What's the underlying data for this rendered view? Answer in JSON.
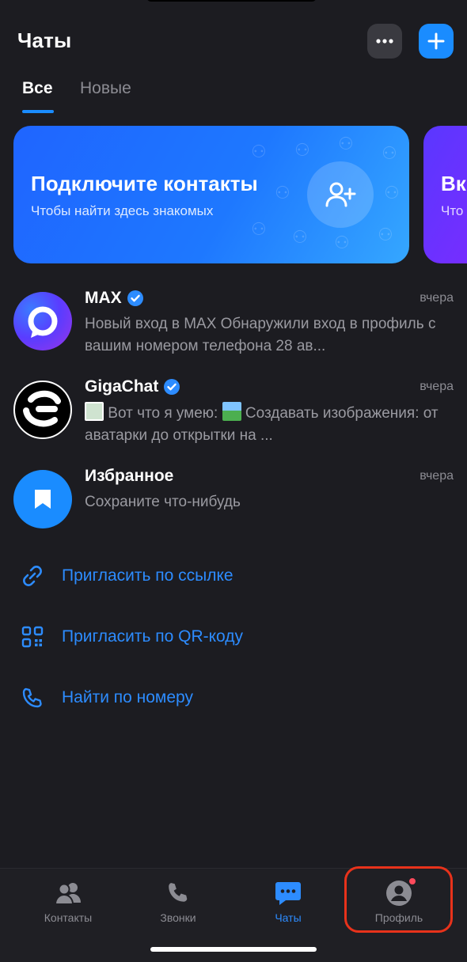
{
  "header": {
    "title": "Чаты",
    "more_icon": "more-icon",
    "add_icon": "plus-icon"
  },
  "tabs": [
    {
      "label": "Все",
      "active": true
    },
    {
      "label": "Новые",
      "active": false
    }
  ],
  "banner": {
    "title": "Подключите контакты",
    "subtitle": "Чтобы найти здесь знакомых",
    "icon": "add-user-icon"
  },
  "banner2": {
    "title": "Вк",
    "subtitle": "Что"
  },
  "chats": [
    {
      "name": "MAX",
      "verified": true,
      "time": "вчера",
      "text": "Новый вход в MAX Обнаружили вход в профиль с вашим номером телефона 28 ав..."
    },
    {
      "name": "GigaChat",
      "verified": true,
      "time": "вчера",
      "text_prefix": "Вот что я умею:",
      "text_rest": "Создавать изображения: от аватарки до открытки на ..."
    },
    {
      "name": "Избранное",
      "verified": false,
      "time": "вчера",
      "text": "Сохраните что-нибудь"
    }
  ],
  "actions": [
    {
      "label": "Пригласить по ссылке",
      "icon": "link-icon"
    },
    {
      "label": "Пригласить по QR-коду",
      "icon": "qr-code-icon"
    },
    {
      "label": "Найти по номеру",
      "icon": "phone-icon"
    }
  ],
  "tabbar": [
    {
      "label": "Контакты",
      "icon": "contacts-icon",
      "active": false
    },
    {
      "label": "Звонки",
      "icon": "phone-icon",
      "active": false
    },
    {
      "label": "Чаты",
      "icon": "chat-icon",
      "active": true
    },
    {
      "label": "Профиль",
      "icon": "profile-icon",
      "active": false,
      "badge": true
    }
  ],
  "colors": {
    "background": "#1c1c21",
    "accent": "#1a8cff",
    "highlight": "#e8321b"
  }
}
